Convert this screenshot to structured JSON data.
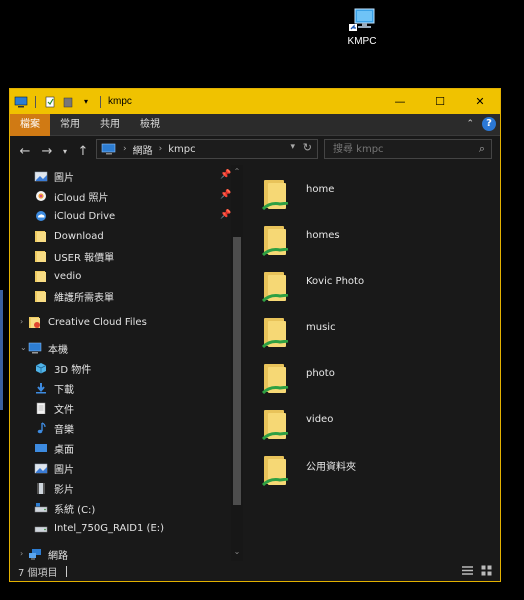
{
  "desktop": {
    "icon_label": "KMPC"
  },
  "window": {
    "title": "kmpc",
    "buttons": {
      "minimize": "—",
      "maximize": "☐",
      "close": "✕"
    }
  },
  "ribbon": {
    "tabs": [
      {
        "label": "檔案",
        "active": true
      },
      {
        "label": "常用",
        "active": false
      },
      {
        "label": "共用",
        "active": false
      },
      {
        "label": "檢視",
        "active": false
      }
    ],
    "help": "?"
  },
  "address": {
    "crumbs": [
      "網路",
      "kmpc"
    ],
    "search_placeholder": "搜尋 kmpc"
  },
  "nav": {
    "quick_access": [
      {
        "label": "圖片",
        "icon": "pictures-icon",
        "pinned": true
      },
      {
        "label": "iCloud 照片",
        "icon": "icloud-photos-icon",
        "pinned": true
      },
      {
        "label": "iCloud Drive",
        "icon": "icloud-drive-icon",
        "pinned": true
      },
      {
        "label": "Download",
        "icon": "folder-icon",
        "pinned": false
      },
      {
        "label": "USER 報價單",
        "icon": "folder-icon",
        "pinned": false
      },
      {
        "label": "vedio",
        "icon": "folder-icon",
        "pinned": false
      },
      {
        "label": "維護所需表單",
        "icon": "folder-icon",
        "pinned": false
      }
    ],
    "creative_cloud": "Creative Cloud Files",
    "this_pc": {
      "label": "本機",
      "children": [
        {
          "label": "3D 物件",
          "icon": "3d-objects-icon"
        },
        {
          "label": "下載",
          "icon": "downloads-icon"
        },
        {
          "label": "文件",
          "icon": "documents-icon"
        },
        {
          "label": "音樂",
          "icon": "music-icon"
        },
        {
          "label": "桌面",
          "icon": "desktop-icon"
        },
        {
          "label": "圖片",
          "icon": "pictures-icon"
        },
        {
          "label": "影片",
          "icon": "videos-icon"
        },
        {
          "label": "系統 (C:)",
          "icon": "system-drive-icon"
        },
        {
          "label": "Intel_750G_RAID1 (E:)",
          "icon": "drive-icon"
        }
      ]
    },
    "network": "網路"
  },
  "folders": [
    "home",
    "homes",
    "Kovic Photo",
    "music",
    "photo",
    "video",
    "公用資料夾"
  ],
  "status": {
    "item_count": "7 個項目"
  },
  "colors": {
    "accent": "#f0c200",
    "ribbon_active": "#d07a14",
    "background": "#191919"
  }
}
